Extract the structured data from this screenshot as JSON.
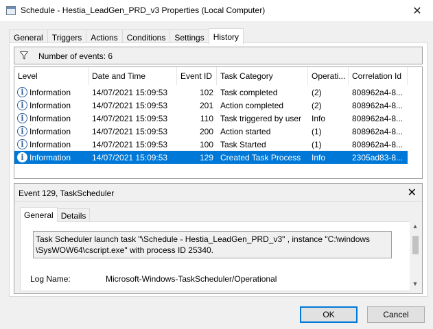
{
  "window": {
    "title": "Schedule - Hestia_LeadGen_PRD_v3 Properties (Local Computer)",
    "close_glyph": "✕"
  },
  "tabs": [
    {
      "label": "General",
      "active": false
    },
    {
      "label": "Triggers",
      "active": false
    },
    {
      "label": "Actions",
      "active": false
    },
    {
      "label": "Conditions",
      "active": false
    },
    {
      "label": "Settings",
      "active": false
    },
    {
      "label": "History",
      "active": true
    }
  ],
  "history": {
    "events_label": "Number of events: 6",
    "columns": [
      "Level",
      "Date and Time",
      "Event ID",
      "Task Category",
      "Operati...",
      "Correlation Id"
    ],
    "rows": [
      {
        "level": "Information",
        "date": "14/07/2021 15:09:53",
        "event_id": "102",
        "category": "Task completed",
        "op": "(2)",
        "corr": "808962a4-8...",
        "selected": false
      },
      {
        "level": "Information",
        "date": "14/07/2021 15:09:53",
        "event_id": "201",
        "category": "Action completed",
        "op": "(2)",
        "corr": "808962a4-8...",
        "selected": false
      },
      {
        "level": "Information",
        "date": "14/07/2021 15:09:53",
        "event_id": "110",
        "category": "Task triggered by user",
        "op": "Info",
        "corr": "808962a4-8...",
        "selected": false
      },
      {
        "level": "Information",
        "date": "14/07/2021 15:09:53",
        "event_id": "200",
        "category": "Action started",
        "op": "(1)",
        "corr": "808962a4-8...",
        "selected": false
      },
      {
        "level": "Information",
        "date": "14/07/2021 15:09:53",
        "event_id": "100",
        "category": "Task Started",
        "op": "(1)",
        "corr": "808962a4-8...",
        "selected": false
      },
      {
        "level": "Information",
        "date": "14/07/2021 15:09:53",
        "event_id": "129",
        "category": "Created Task Process",
        "op": "Info",
        "corr": "2305ad83-8...",
        "selected": true
      }
    ]
  },
  "detail": {
    "title": "Event 129, TaskScheduler",
    "close_glyph": "✕",
    "tabs": [
      {
        "label": "General",
        "active": true
      },
      {
        "label": "Details",
        "active": false
      }
    ],
    "description_line1": "Task Scheduler launch task \"\\Schedule - Hestia_LeadGen_PRD_v3\" , instance \"C:\\windows",
    "description_line2": "\\SysWOW64\\cscript.exe\"  with process ID 25340.",
    "log_name_label": "Log Name:",
    "log_name_value": "Microsoft-Windows-TaskScheduler/Operational"
  },
  "buttons": {
    "ok": "OK",
    "cancel": "Cancel"
  },
  "colors": {
    "selection": "#0078d7",
    "info_icon": "#2d5d9a"
  }
}
